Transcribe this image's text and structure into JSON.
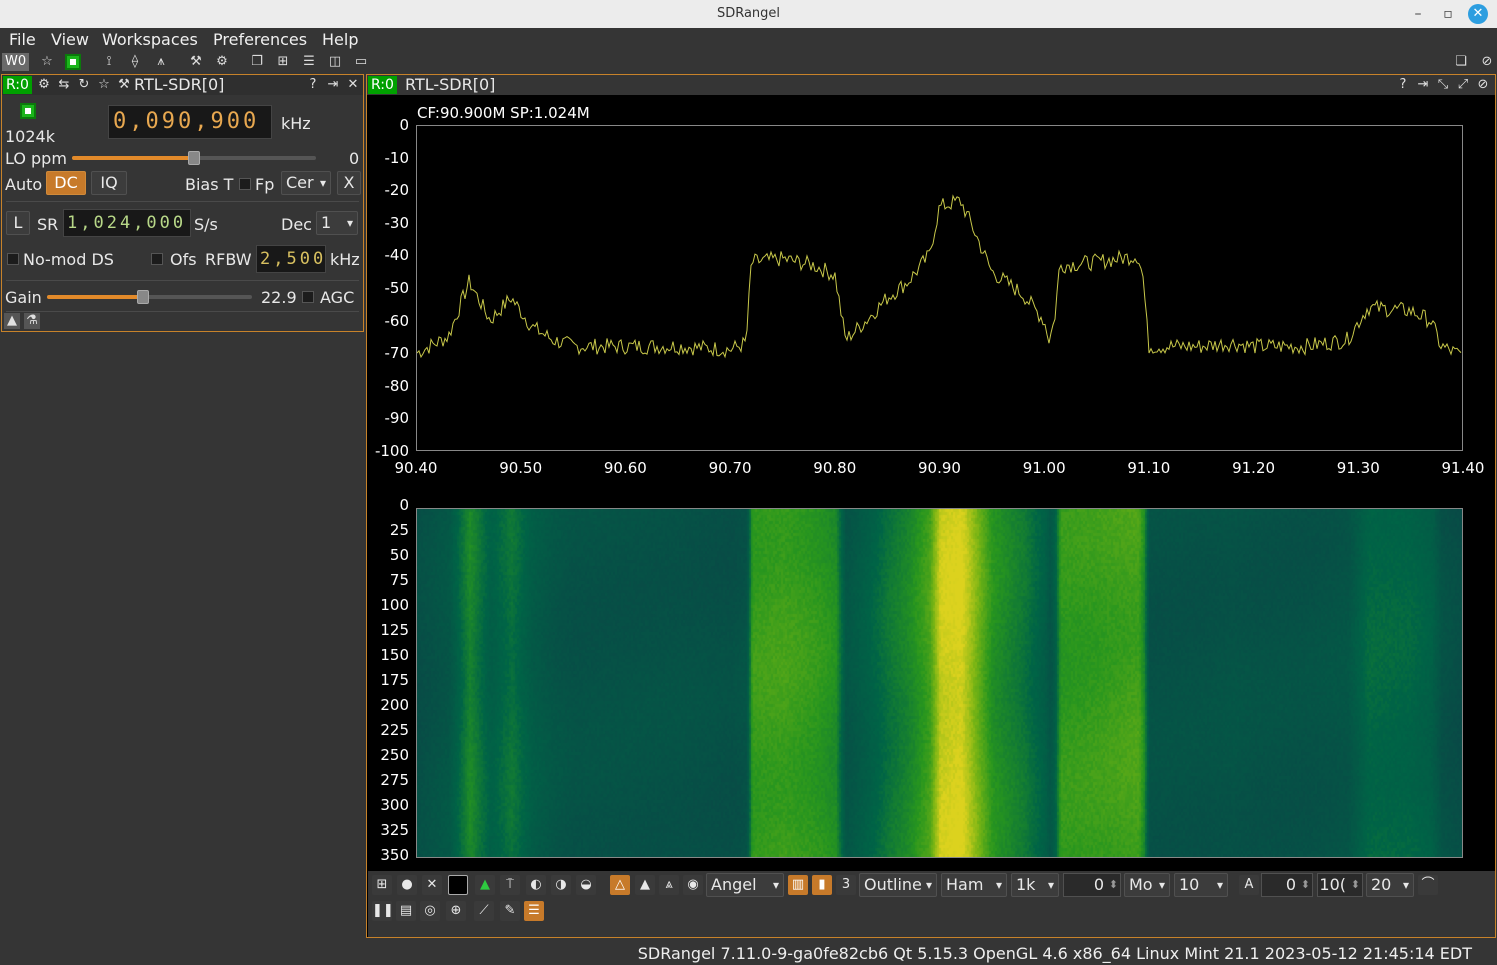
{
  "window": {
    "title": "SDRangel"
  },
  "menu": [
    "File",
    "View",
    "Workspaces",
    "Preferences",
    "Help"
  ],
  "toolbar": {
    "workspace": "W0"
  },
  "device": {
    "badge": "R:0",
    "name": "RTL-SDR[0]",
    "sample_rate_label": "1024k",
    "frequency": "0,090,900",
    "freq_unit": "kHz",
    "lo_ppm_label": "LO ppm",
    "lo_ppm_value": "0",
    "lo_ppm_level": 0.5,
    "auto_label": "Auto",
    "dc_label": "DC",
    "iq_label": "IQ",
    "bias_t_label": "Bias T",
    "fp_label": "Fp",
    "fp_combo": "Cer",
    "x_label": "X",
    "l_label": "L",
    "sr_label": "SR",
    "sr_value": "1,024,000",
    "sr_unit": "S/s",
    "dec_label": "Dec",
    "dec_value": "1",
    "nomod_label": "No-mod DS",
    "ofs_label": "Ofs",
    "rfbw_label": "RFBW",
    "rfbw_value": "2,500",
    "rfbw_unit": "kHz",
    "gain_label": "Gain",
    "gain_value": "22.9",
    "gain_level": 0.47,
    "agc_label": "AGC"
  },
  "spectrum": {
    "badge": "R:0",
    "name": "RTL-SDR[0]",
    "cf_sp": "CF:90.900M SP:1.024M",
    "trace_color": "#c8c84a"
  },
  "chart_data": {
    "type": "line",
    "ylim": [
      -100,
      0
    ],
    "xlim": [
      90.4,
      91.4
    ],
    "yticks": [
      "0",
      "-10",
      "-20",
      "-30",
      "-40",
      "-50",
      "-60",
      "-70",
      "-80",
      "-90",
      "-100"
    ],
    "xticks": [
      "90.40",
      "90.50",
      "90.60",
      "90.70",
      "90.80",
      "90.90",
      "91.00",
      "91.10",
      "91.20",
      "91.30",
      "91.40"
    ],
    "x": [
      90.4,
      90.43,
      90.45,
      90.47,
      90.49,
      90.51,
      90.53,
      90.55,
      90.6,
      90.65,
      90.7,
      90.715,
      90.72,
      90.75,
      90.78,
      90.8,
      90.81,
      90.83,
      90.85,
      90.87,
      90.89,
      90.9,
      90.92,
      90.93,
      90.95,
      90.98,
      91.0,
      91.005,
      91.01,
      91.015,
      91.05,
      91.09,
      91.095,
      91.1,
      91.15,
      91.18,
      91.2,
      91.25,
      91.29,
      91.31,
      91.35,
      91.37,
      91.38,
      91.4
    ],
    "y": [
      -70,
      -65,
      -48,
      -60,
      -53,
      -62,
      -66,
      -68,
      -68,
      -68,
      -69,
      -67,
      -42,
      -41,
      -43,
      -46,
      -66,
      -60,
      -53,
      -48,
      -40,
      -25,
      -23,
      -30,
      -45,
      -52,
      -60,
      -66,
      -60,
      -43,
      -42,
      -40,
      -47,
      -68,
      -68,
      -67,
      -68,
      -68,
      -66,
      -56,
      -57,
      -60,
      -68,
      -71
    ],
    "waterfall_yticks": [
      "0",
      "25",
      "50",
      "75",
      "100",
      "125",
      "150",
      "175",
      "200",
      "225",
      "250",
      "275",
      "300",
      "325",
      "350"
    ]
  },
  "spectrum_toolbar": {
    "palette": "Angel",
    "outline": "Outline",
    "window": "Ham",
    "fft_size": "1k",
    "ref_value": "0",
    "mode": "Mo",
    "range": "10",
    "avg_label": "A",
    "avg_value": "0",
    "rate_value": "10(",
    "fps": "20"
  },
  "status": {
    "text": "SDRangel 7.11.0-9-ga0fe82cb6 Qt 5.15.3 OpenGL 4.6 x86_64 Linux Mint 21.1 2023-05-12 21:45:14 EDT"
  }
}
